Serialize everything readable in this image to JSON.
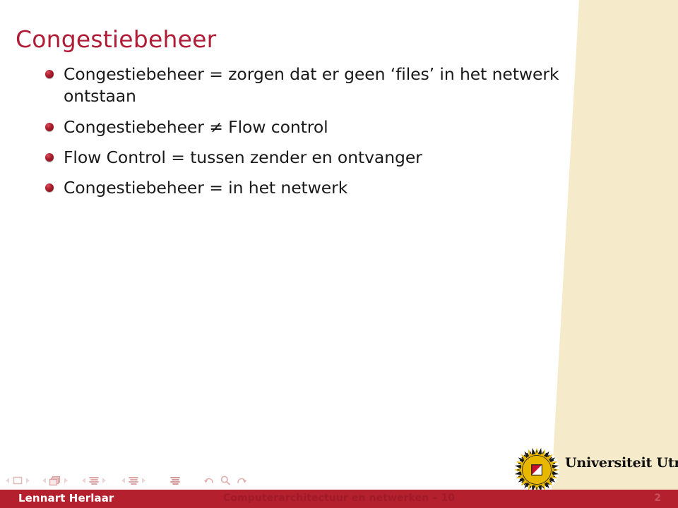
{
  "slide": {
    "title": "Congestiebeheer",
    "page_number": "2",
    "title_color": "#b01c36",
    "footer_bar_color": "#b5202f",
    "beige_band_color": "#f5ebca",
    "bullets": [
      {
        "text": "Congestiebeheer = zorgen dat er geen ‘files’ in het netwerk ontstaan"
      },
      {
        "text": "Congestiebeheer ≠ Flow control"
      },
      {
        "text": "Flow Control = tussen zender en ontvanger"
      },
      {
        "text": "Congestiebeheer = in het netwerk"
      }
    ]
  },
  "footer": {
    "author": "Lennart Herlaar",
    "course": "Computerarchitectuur en netwerken – 10",
    "page_number": "2"
  },
  "logo": {
    "wordmark": "Universiteit Utrecht",
    "sunburst_color": "#e8b800",
    "shield_color": "#c8102e"
  },
  "navigation": {
    "groups": [
      {
        "name": "slide-nav",
        "icon": "slide-icon"
      },
      {
        "name": "frame-nav",
        "icon": "frames-icon"
      },
      {
        "name": "subsection-nav",
        "icon": "subsection-icon"
      },
      {
        "name": "section-nav",
        "icon": "section-icon"
      },
      {
        "name": "presentation-nav",
        "icon": "presentation-icon"
      }
    ],
    "controls": [
      {
        "name": "back-button",
        "icon": "back-arrow-icon"
      },
      {
        "name": "find-button",
        "icon": "search-icon"
      },
      {
        "name": "forward-button",
        "icon": "forward-arrow-icon"
      }
    ]
  }
}
